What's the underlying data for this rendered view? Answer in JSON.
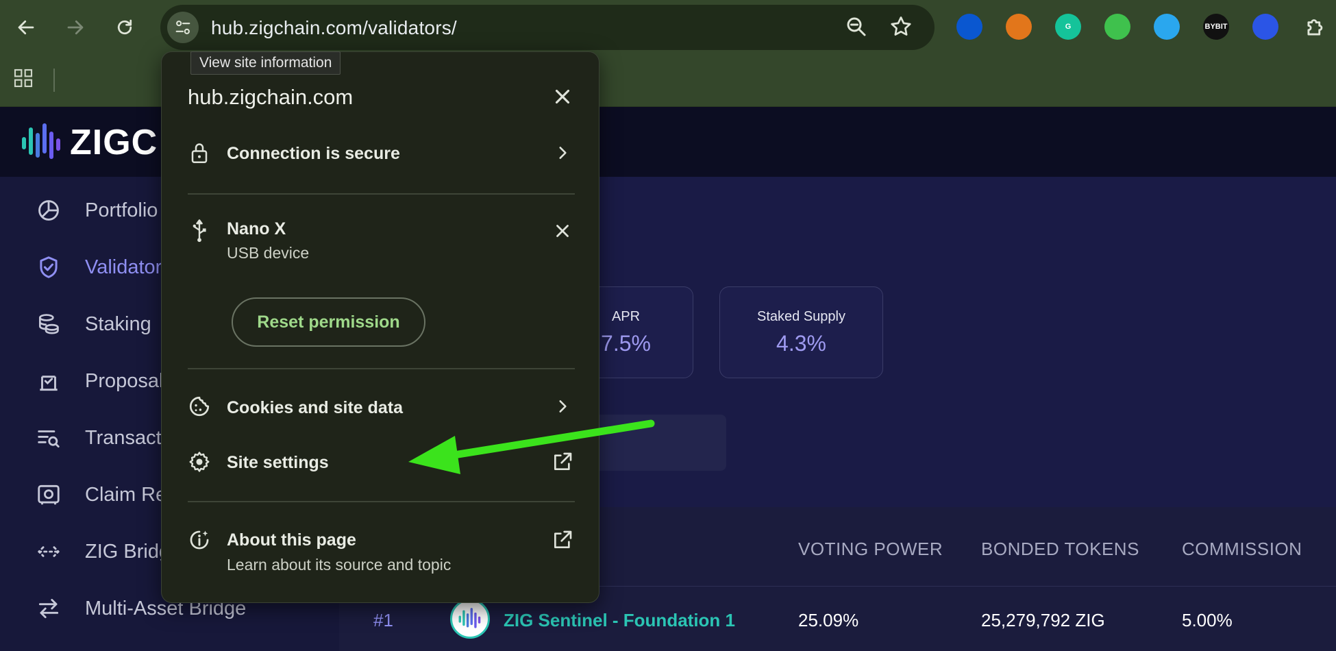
{
  "browser": {
    "url": "hub.zigchain.com/validators/",
    "tooltip": "View site information",
    "extensions": [
      {
        "name": "1password-icon",
        "label": "",
        "color": "#0a57d0"
      },
      {
        "name": "metamask-icon",
        "label": "",
        "color": "#e2761b"
      },
      {
        "name": "grammarly-icon",
        "label": "G",
        "color": "#15c39a"
      },
      {
        "name": "frog-extension-icon",
        "label": "",
        "color": "#3fc14d"
      },
      {
        "name": "lightning-extension-icon",
        "label": "",
        "color": "#2aa7ee"
      },
      {
        "name": "bybit-wallet-icon",
        "label": "BYBIT",
        "color": "#111111"
      },
      {
        "name": "circle-extension-icon",
        "label": "",
        "color": "#2b55e6"
      }
    ]
  },
  "app": {
    "brand": "ZIGC",
    "sidebar": [
      {
        "label": "Portfolio",
        "icon": "pie-chart-icon"
      },
      {
        "label": "Validators",
        "icon": "shield-check-icon",
        "active": true
      },
      {
        "label": "Staking",
        "icon": "coins-stack-icon"
      },
      {
        "label": "Proposals",
        "icon": "ballot-box-icon"
      },
      {
        "label": "Transactions",
        "icon": "search-list-icon"
      },
      {
        "label": "Claim Rewards",
        "icon": "safe-icon"
      },
      {
        "label": "ZIG Bridge",
        "icon": "arrows-horizontal-icon"
      },
      {
        "label": "Multi-Asset Bridge",
        "icon": "swap-arrows-icon"
      }
    ],
    "stats": [
      {
        "label": "APR",
        "value": "7.5%"
      },
      {
        "label": "Staked Supply",
        "value": "4.3%"
      }
    ],
    "table": {
      "headers": [
        "VOTING POWER",
        "BONDED TOKENS",
        "COMMISSION"
      ],
      "rows": [
        {
          "rank": "#1",
          "name": "ZIG Sentinel - Foundation 1",
          "voting_power": "25.09%",
          "bonded_tokens": "25,279,792 ZIG",
          "commission": "5.00%"
        }
      ]
    }
  },
  "popup": {
    "domain": "hub.zigchain.com",
    "connection": "Connection is secure",
    "device_name": "Nano X",
    "device_type": "USB device",
    "reset_label": "Reset permission",
    "cookies": "Cookies and site data",
    "site_settings": "Site settings",
    "about_title": "About this page",
    "about_sub": "Learn about its source and topic"
  },
  "colors": {
    "accent": "#8f8ff2",
    "arrow": "#3be31c",
    "teal": "#2bc5b4"
  }
}
